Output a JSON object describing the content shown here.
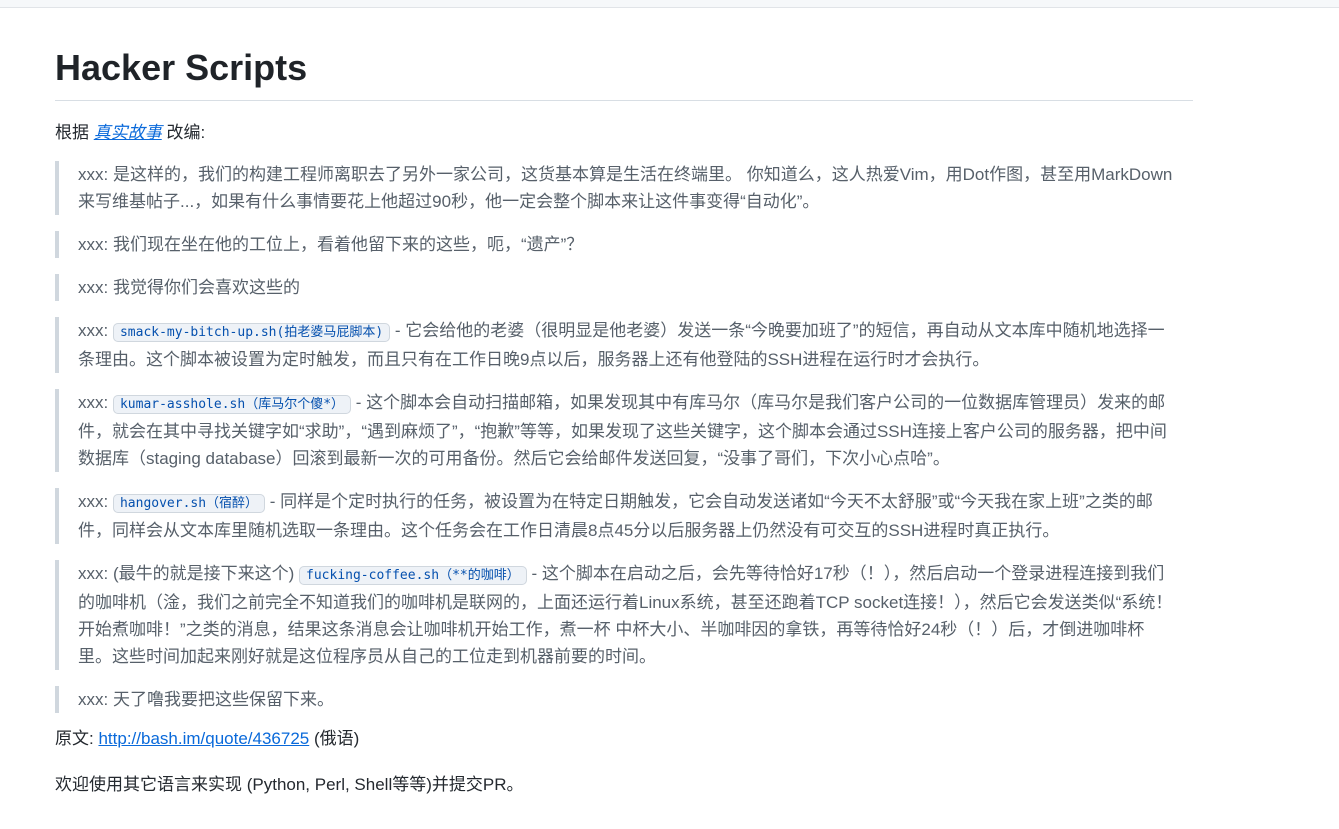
{
  "title": "Hacker Scripts",
  "intro": {
    "prefix": "根据",
    "link_text": "真实故事",
    "suffix": "改编:"
  },
  "quotes": [
    {
      "speaker": "xxx:",
      "text": "是这样的，我们的构建工程师离职去了另外一家公司，这货基本算是生活在终端里。 你知道么，这人热爱Vim，用Dot作图，甚至用MarkDown来写维基帖子...，如果有什么事情要花上他超过90秒，他一定会整个脚本来让这件事变得“自动化”。"
    },
    {
      "speaker": "xxx:",
      "text": "我们现在坐在他的工位上，看着他留下来的这些，呃，“遗产”？"
    },
    {
      "speaker": "xxx:",
      "text": "我觉得你们会喜欢这些的"
    },
    {
      "speaker": "xxx:",
      "code": "smack-my-bitch-up.sh(拍老婆马屁脚本)",
      "text": "- 它会给他的老婆（很明显是他老婆）发送一条“今晚要加班了”的短信，再自动从文本库中随机地选择一条理由。这个脚本被设置为定时触发，而且只有在工作日晚9点以后，服务器上还有他登陆的SSH进程在运行时才会执行。"
    },
    {
      "speaker": "xxx:",
      "code": "kumar-asshole.sh（库马尔个傻*）",
      "text": "- 这个脚本会自动扫描邮箱，如果发现其中有库马尔（库马尔是我们客户公司的一位数据库管理员）发来的邮件，就会在其中寻找关键字如“求助”，“遇到麻烦了”，“抱歉”等等，如果发现了这些关键字，这个脚本会通过SSH连接上客户公司的服务器，把中间数据库（staging database）回滚到最新一次的可用备份。然后它会给邮件发送回复，“没事了哥们，下次小心点哈”。"
    },
    {
      "speaker": "xxx:",
      "code": "hangover.sh（宿醉）",
      "text": "- 同样是个定时执行的任务，被设置为在特定日期触发，它会自动发送诸如“今天不太舒服”或“今天我在家上班”之类的邮件，同样会从文本库里随机选取一条理由。这个任务会在工作日清晨8点45分以后服务器上仍然没有可交互的SSH进程时真正执行。"
    },
    {
      "speaker": "xxx: (最牛的就是接下来这个)",
      "code": "fucking-coffee.sh（**的咖啡）",
      "text": "- 这个脚本在启动之后，会先等待恰好17秒（！），然后启动一个登录进程连接到我们的咖啡机（淦，我们之前完全不知道我们的咖啡机是联网的，上面还运行着Linux系统，甚至还跑着TCP socket连接！），然后它会发送类似“系统！开始煮咖啡！”之类的消息，结果这条消息会让咖啡机开始工作，煮一杯 中杯大小、半咖啡因的拿铁，再等待恰好24秒（！）后，才倒进咖啡杯里。这些时间加起来刚好就是这位程序员从自己的工位走到机器前要的时间。"
    },
    {
      "speaker": "xxx:",
      "text": "天了噜我要把这些保留下来。"
    }
  ],
  "source": {
    "label": "原文:",
    "link_text": "http://bash.im/quote/436725",
    "suffix": "(俄语)"
  },
  "footer": "欢迎使用其它语言来实现 (Python, Perl, Shell等等)并提交PR。"
}
